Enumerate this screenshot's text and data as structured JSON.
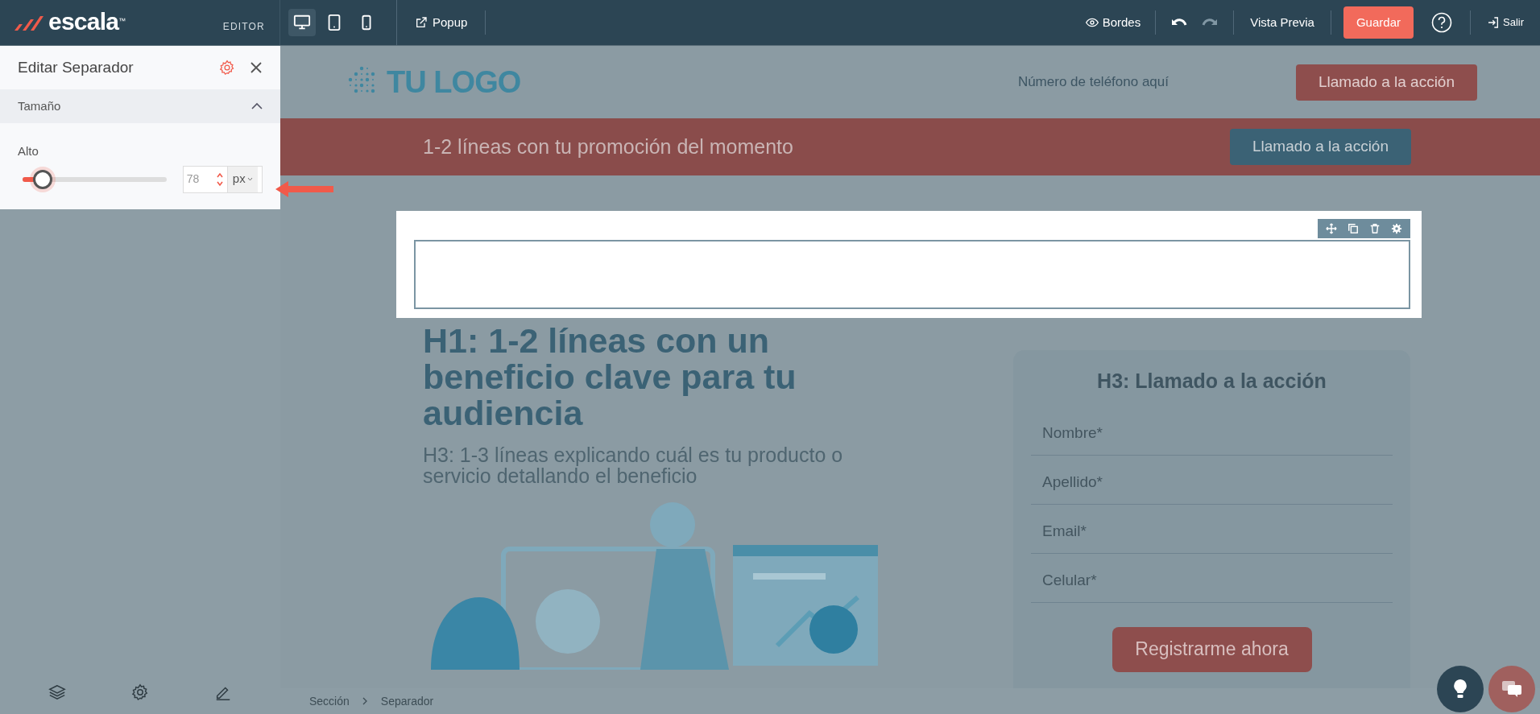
{
  "topbar": {
    "logo_text": "escala",
    "trademark": "™",
    "mode_label": "EDITOR",
    "devices": [
      {
        "kind": "desktop",
        "selected": true
      },
      {
        "kind": "tablet",
        "selected": false
      },
      {
        "kind": "phone",
        "selected": false
      }
    ],
    "popup": "Popup",
    "borders": "Bordes",
    "preview": "Vista Previa",
    "save": "Guardar",
    "exit": "Salir"
  },
  "panel": {
    "title": "Editar Separador",
    "section": {
      "title": "Tamaño",
      "expanded": true
    },
    "field": {
      "label": "Alto",
      "level": 0.14,
      "value": "78",
      "unit": "px"
    }
  },
  "canvas": {
    "logo": "TU LOGO",
    "phone": "Número de teléfono aquí",
    "header_cta": "Llamado a la acción",
    "promo_text": "1-2 líneas con tu promoción del momento",
    "promo_cta": "Llamado a la acción",
    "headline": "H1: 1-2 líneas con un beneficio clave para tu audiencia",
    "subheadline": "H3: 1-3 líneas explicando cuál es tu producto o servicio detallando el beneficio",
    "form": {
      "title": "H3: Llamado a la acción",
      "fields": [
        {
          "placeholder": "Nombre*"
        },
        {
          "placeholder": "Apellido*"
        },
        {
          "placeholder": "Email*"
        },
        {
          "placeholder": "Celular*"
        }
      ],
      "submit": "Registrarme ahora"
    }
  },
  "breadcrumb": [
    "Sección",
    "Separador"
  ]
}
